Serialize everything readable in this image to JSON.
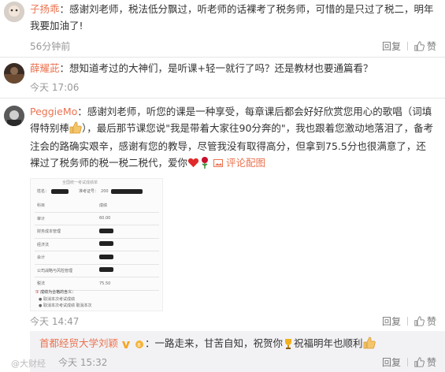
{
  "comments": [
    {
      "name": "子扬乖",
      "text": "：感谢刘老师，税法低分飘过，听老师的话裸考了税务师，可惜的是只过了税二，明年我要加油了!",
      "time": "56分钟前",
      "reply": "回复",
      "like": "赞"
    },
    {
      "name": "薛耀茈",
      "text": "：想知道考过的大神们，是听课+轻一就行了吗？还是教材也要通篇看？",
      "time": "今天 17:06",
      "reply": "回复",
      "like": "赞"
    },
    {
      "name": "PeggieMo",
      "text_a": "：感谢刘老师，听您的课是一种享受，每章课后都会好好欣赏您用心的歌唱（词填得特别棒",
      "text_b": "），最后那节课您说\"我是带着大家往90分奔的\"，我也跟着您激动地落泪了，备考注会的路确实艰辛，感谢有您的教导，尽管我没有取得高分，但拿到75.5分也很满意了，还裸过了税务师的税一税二税代，爱你",
      "link": "评论配图",
      "time": "今天 14:47",
      "reply": "回复",
      "like": "赞"
    }
  ],
  "photo": {
    "header": "全国统一考试成绩单",
    "name_label": "姓名：",
    "id_label": "准考证号：",
    "id_value": "200",
    "col_subject": "科目",
    "col_score": "成绩",
    "rows": [
      {
        "subject": "审计",
        "score": "60.00"
      },
      {
        "subject": "财务成本管理",
        "score": ""
      },
      {
        "subject": "经济法",
        "score": ""
      },
      {
        "subject": "会计",
        "score": ""
      },
      {
        "subject": "公司战略与风险管理",
        "score": ""
      },
      {
        "subject": "税法",
        "score": "75.50"
      }
    ],
    "note": "成绩为合格的含义：",
    "note_a": "● 取消本次考试成绩",
    "note_b": "● 取消本次考试成绩 取消本次"
  },
  "reply_box": {
    "name": "首都经贸大学刘颖",
    "text": "：一路走来，甘苦自知，祝贺你",
    "text_b": "祝福明年也顺利",
    "time": "今天 15:32",
    "reply": "回复",
    "like": "赞"
  },
  "watermark": "@大财经"
}
